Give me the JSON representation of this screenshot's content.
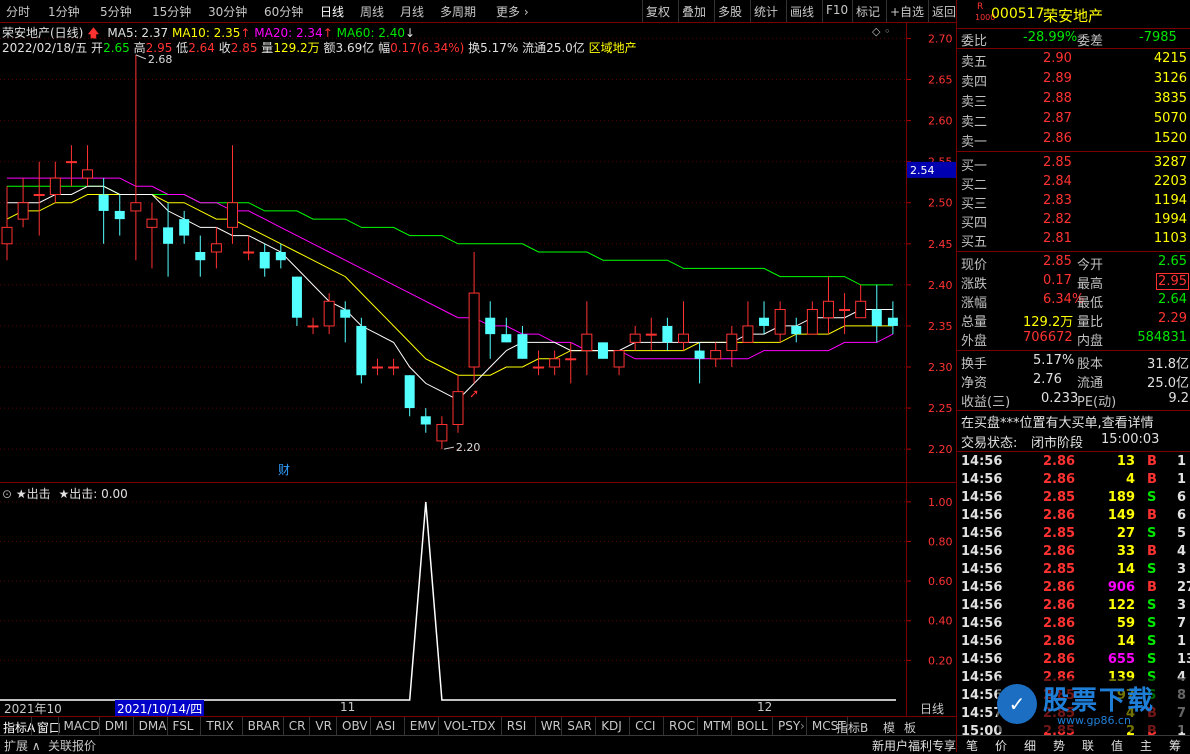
{
  "toolbar": {
    "left": [
      "分时",
      "1分钟",
      "5分钟",
      "15分钟",
      "30分钟",
      "60分钟",
      "日线",
      "周线",
      "月线",
      "多周期",
      "更多 ›"
    ],
    "right": [
      "复权",
      "叠加",
      "多股",
      "统计",
      "画线",
      "F10",
      "标记",
      "+自选",
      "返回"
    ]
  },
  "info": {
    "title": "荣安地产(日线)",
    "ma5": "MA5: 2.37",
    "ma10": "MA10: 2.35",
    "ma20": "MA20: 2.34",
    "ma60": "MA60: 2.40",
    "date": "2022/02/18/五",
    "open_l": "开",
    "open": "2.65",
    "high_l": "高",
    "high": "2.95",
    "low_l": "低",
    "low": "2.64",
    "close_l": "收",
    "close": "2.85",
    "vol_l": "量",
    "vol": "129.2万",
    "amt_l": "额",
    "amt": "3.69亿",
    "chg_l": "幅",
    "chg": "0.17(6.34%)",
    "turn": "换5.17%",
    "float": "流通25.0亿",
    "sector": "区域地产"
  },
  "sub_info": {
    "name1": "★出击",
    "name2": "★出击: 0.00"
  },
  "colors": {
    "up": "#ff3232",
    "down": "#54ffff",
    "ma5": "#ffffff",
    "ma10": "#ffff00",
    "ma20": "#ff00ff",
    "ma60": "#00ff00"
  },
  "chart_data": {
    "type": "candlestick",
    "price_axis": {
      "min": 2.16,
      "max": 2.72,
      "ticks": [
        "2.70",
        "2.65",
        "2.60",
        "2.55",
        "2.50",
        "2.45",
        "2.40",
        "2.35",
        "2.30",
        "2.25",
        "2.20"
      ],
      "current_marker": "2.54"
    },
    "sub_axis": {
      "min": 0,
      "max": 1.08,
      "ticks": [
        "1.00",
        "0.80",
        "0.60",
        "0.40",
        "0.20"
      ]
    },
    "annotations": {
      "high": "2.68",
      "low": "2.20",
      "fin": "财"
    },
    "dates": {
      "start": "2021年10",
      "cursor": "2021/10/14/四",
      "m11": "11",
      "m12": "12"
    },
    "candles": [
      [
        2.45,
        2.47,
        2.52,
        2.43
      ],
      [
        2.48,
        2.5,
        2.53,
        2.47
      ],
      [
        2.51,
        2.51,
        2.55,
        2.46
      ],
      [
        2.51,
        2.53,
        2.55,
        2.5
      ],
      [
        2.55,
        2.55,
        2.57,
        2.52
      ],
      [
        2.53,
        2.54,
        2.57,
        2.52
      ],
      [
        2.51,
        2.49,
        2.53,
        2.45
      ],
      [
        2.49,
        2.48,
        2.51,
        2.46
      ],
      [
        2.49,
        2.5,
        2.68,
        2.43
      ],
      [
        2.47,
        2.48,
        2.5,
        2.42
      ],
      [
        2.47,
        2.45,
        2.5,
        2.41
      ],
      [
        2.48,
        2.46,
        2.49,
        2.45
      ],
      [
        2.44,
        2.43,
        2.46,
        2.41
      ],
      [
        2.44,
        2.45,
        2.47,
        2.42
      ],
      [
        2.47,
        2.5,
        2.57,
        2.45
      ],
      [
        2.44,
        2.44,
        2.46,
        2.43
      ],
      [
        2.44,
        2.42,
        2.45,
        2.41
      ],
      [
        2.44,
        2.43,
        2.45,
        2.42
      ],
      [
        2.41,
        2.36,
        2.41,
        2.35
      ],
      [
        2.35,
        2.35,
        2.36,
        2.34
      ],
      [
        2.35,
        2.38,
        2.39,
        2.34
      ],
      [
        2.37,
        2.36,
        2.38,
        2.33
      ],
      [
        2.35,
        2.29,
        2.36,
        2.28
      ],
      [
        2.3,
        2.3,
        2.31,
        2.29
      ],
      [
        2.3,
        2.3,
        2.31,
        2.29
      ],
      [
        2.29,
        2.25,
        2.29,
        2.24
      ],
      [
        2.24,
        2.23,
        2.25,
        2.22
      ],
      [
        2.21,
        2.23,
        2.24,
        2.2
      ],
      [
        2.23,
        2.27,
        2.29,
        2.22
      ],
      [
        2.3,
        2.39,
        2.44,
        2.28
      ],
      [
        2.36,
        2.34,
        2.38,
        2.31
      ],
      [
        2.34,
        2.33,
        2.36,
        2.33
      ],
      [
        2.34,
        2.31,
        2.35,
        2.31
      ],
      [
        2.3,
        2.3,
        2.32,
        2.29
      ],
      [
        2.3,
        2.31,
        2.32,
        2.29
      ],
      [
        2.31,
        2.31,
        2.33,
        2.28
      ],
      [
        2.32,
        2.34,
        2.38,
        2.29
      ],
      [
        2.33,
        2.31,
        2.33,
        2.31
      ],
      [
        2.3,
        2.32,
        2.32,
        2.29
      ],
      [
        2.33,
        2.34,
        2.35,
        2.32
      ],
      [
        2.34,
        2.34,
        2.36,
        2.32
      ],
      [
        2.35,
        2.33,
        2.36,
        2.32
      ],
      [
        2.33,
        2.34,
        2.38,
        2.32
      ],
      [
        2.32,
        2.31,
        2.33,
        2.28
      ],
      [
        2.31,
        2.32,
        2.33,
        2.3
      ],
      [
        2.32,
        2.34,
        2.35,
        2.3
      ],
      [
        2.33,
        2.35,
        2.38,
        2.33
      ],
      [
        2.36,
        2.35,
        2.38,
        2.34
      ],
      [
        2.34,
        2.37,
        2.38,
        2.33
      ],
      [
        2.35,
        2.34,
        2.36,
        2.33
      ],
      [
        2.34,
        2.37,
        2.38,
        2.34
      ],
      [
        2.36,
        2.38,
        2.41,
        2.34
      ],
      [
        2.37,
        2.37,
        2.39,
        2.34
      ],
      [
        2.36,
        2.38,
        2.4,
        2.36
      ],
      [
        2.37,
        2.35,
        2.4,
        2.33
      ],
      [
        2.36,
        2.35,
        2.38,
        2.34
      ]
    ],
    "ma5": [
      2.5,
      2.5,
      2.5,
      2.51,
      2.51,
      2.52,
      2.52,
      2.51,
      2.51,
      2.51,
      2.49,
      2.48,
      2.47,
      2.47,
      2.46,
      2.46,
      2.45,
      2.44,
      2.42,
      2.4,
      2.38,
      2.37,
      2.35,
      2.34,
      2.33,
      2.3,
      2.28,
      2.27,
      2.26,
      2.28,
      2.3,
      2.32,
      2.33,
      2.33,
      2.33,
      2.32,
      2.32,
      2.32,
      2.32,
      2.33,
      2.33,
      2.33,
      2.33,
      2.33,
      2.33,
      2.33,
      2.34,
      2.34,
      2.35,
      2.35,
      2.36,
      2.36,
      2.36,
      2.37,
      2.37,
      2.37
    ],
    "ma10": [
      2.48,
      2.49,
      2.49,
      2.5,
      2.5,
      2.51,
      2.51,
      2.51,
      2.51,
      2.51,
      2.5,
      2.5,
      2.49,
      2.48,
      2.48,
      2.47,
      2.46,
      2.45,
      2.44,
      2.43,
      2.42,
      2.41,
      2.39,
      2.37,
      2.35,
      2.33,
      2.31,
      2.3,
      2.29,
      2.29,
      2.29,
      2.3,
      2.3,
      2.31,
      2.31,
      2.32,
      2.32,
      2.32,
      2.32,
      2.32,
      2.32,
      2.32,
      2.32,
      2.33,
      2.33,
      2.33,
      2.33,
      2.33,
      2.33,
      2.34,
      2.34,
      2.34,
      2.35,
      2.35,
      2.35,
      2.35
    ],
    "ma20": [
      2.53,
      2.53,
      2.53,
      2.53,
      2.53,
      2.53,
      2.53,
      2.53,
      2.52,
      2.52,
      2.51,
      2.51,
      2.5,
      2.5,
      2.49,
      2.49,
      2.48,
      2.47,
      2.46,
      2.45,
      2.44,
      2.43,
      2.42,
      2.41,
      2.4,
      2.39,
      2.38,
      2.37,
      2.36,
      2.36,
      2.35,
      2.35,
      2.34,
      2.34,
      2.33,
      2.33,
      2.32,
      2.32,
      2.32,
      2.31,
      2.31,
      2.31,
      2.31,
      2.31,
      2.31,
      2.31,
      2.31,
      2.32,
      2.32,
      2.32,
      2.32,
      2.32,
      2.33,
      2.33,
      2.33,
      2.34
    ],
    "ma60": [
      2.52,
      2.52,
      2.52,
      2.52,
      2.52,
      2.52,
      2.52,
      2.51,
      2.51,
      2.51,
      2.51,
      2.51,
      2.5,
      2.5,
      2.5,
      2.5,
      2.49,
      2.49,
      2.49,
      2.48,
      2.48,
      2.48,
      2.47,
      2.47,
      2.47,
      2.46,
      2.46,
      2.46,
      2.45,
      2.45,
      2.45,
      2.45,
      2.45,
      2.44,
      2.44,
      2.44,
      2.44,
      2.43,
      2.43,
      2.43,
      2.43,
      2.43,
      2.42,
      2.42,
      2.42,
      2.42,
      2.42,
      2.42,
      2.41,
      2.41,
      2.41,
      2.41,
      2.41,
      2.4,
      2.4,
      2.4
    ],
    "signal": {
      "peak_index": 26,
      "value": 1.0
    }
  },
  "indicators": {
    "items": [
      "指标A",
      "窗口",
      "MACD",
      "DMI",
      "DMA",
      "FSL",
      "TRIX",
      "BRAR",
      "CR",
      "VR",
      "OBV",
      "ASI",
      "EMV",
      "VOL-TDX",
      "RSI",
      "WR",
      "SAR",
      "KDJ",
      "CCI",
      "ROC",
      "MTM",
      "BOLL",
      "PSY",
      "MCST"
    ],
    "right": [
      "指标B",
      "模",
      "板"
    ]
  },
  "footer": {
    "left": [
      "扩展 ∧",
      "关联报价"
    ],
    "promo": "新用户福利专享",
    "tabs": [
      "笔",
      "价",
      "细",
      "势",
      "联",
      "值",
      "主",
      "筹"
    ],
    "period": "日线"
  },
  "panel": {
    "code": "000517",
    "name": "荣安地产",
    "badge_r": "R",
    "badge_num": "1000",
    "weibi_l": "委比",
    "weibi": "-28.99%",
    "weicha_l": "委差",
    "weicha": "-7985",
    "sells": [
      {
        "label": "卖五",
        "price": "2.90",
        "vol": "4215"
      },
      {
        "label": "卖四",
        "price": "2.89",
        "vol": "3126"
      },
      {
        "label": "卖三",
        "price": "2.88",
        "vol": "3835"
      },
      {
        "label": "卖二",
        "price": "2.87",
        "vol": "5070"
      },
      {
        "label": "卖一",
        "price": "2.86",
        "vol": "1520"
      }
    ],
    "buys": [
      {
        "label": "买一",
        "price": "2.85",
        "vol": "3287"
      },
      {
        "label": "买二",
        "price": "2.84",
        "vol": "2203"
      },
      {
        "label": "买三",
        "price": "2.83",
        "vol": "1194"
      },
      {
        "label": "买四",
        "price": "2.82",
        "vol": "1994"
      },
      {
        "label": "买五",
        "price": "2.81",
        "vol": "1103"
      }
    ],
    "stats": [
      {
        "l1": "现价",
        "v1": "2.85",
        "c1": "red",
        "l2": "今开",
        "v2": "2.65",
        "c2": "green"
      },
      {
        "l1": "涨跌",
        "v1": "0.17",
        "c1": "red",
        "l2": "最高",
        "v2": "2.95",
        "c2": "red"
      },
      {
        "l1": "涨幅",
        "v1": "6.34%",
        "c1": "red",
        "l2": "最低",
        "v2": "2.64",
        "c2": "green"
      },
      {
        "l1": "总量",
        "v1": "129.2万",
        "c1": "yellow",
        "l2": "量比",
        "v2": "2.29",
        "c2": "red"
      },
      {
        "l1": "外盘",
        "v1": "706672",
        "c1": "red",
        "l2": "内盘",
        "v2": "584831",
        "c2": "green"
      }
    ],
    "stats2": [
      {
        "l1": "换手",
        "v1": "5.17%",
        "l2": "股本",
        "v2": "31.8亿"
      },
      {
        "l1": "净资",
        "v1": "2.76",
        "l2": "流通",
        "v2": "25.0亿"
      },
      {
        "l1": "收益(三)",
        "v1": "0.233",
        "l2": "PE(动)",
        "v2": "9.2"
      }
    ],
    "notice": "在买盘***位置有大买单,查看详情",
    "status_l": "交易状态:",
    "status": "闭市阶段",
    "status_time": "15:00:03",
    "ticks": [
      {
        "t": "14:56",
        "p": "2.86",
        "v": "13",
        "s": "B",
        "n": "1",
        "vc": "yellow"
      },
      {
        "t": "14:56",
        "p": "2.86",
        "v": "4",
        "s": "B",
        "n": "1",
        "vc": "yellow"
      },
      {
        "t": "14:56",
        "p": "2.85",
        "v": "189",
        "s": "S",
        "n": "6",
        "vc": "yellow"
      },
      {
        "t": "14:56",
        "p": "2.86",
        "v": "149",
        "s": "B",
        "n": "6",
        "vc": "yellow"
      },
      {
        "t": "14:56",
        "p": "2.85",
        "v": "27",
        "s": "S",
        "n": "5",
        "vc": "yellow"
      },
      {
        "t": "14:56",
        "p": "2.86",
        "v": "33",
        "s": "B",
        "n": "4",
        "vc": "yellow"
      },
      {
        "t": "14:56",
        "p": "2.85",
        "v": "14",
        "s": "S",
        "n": "3",
        "vc": "yellow"
      },
      {
        "t": "14:56",
        "p": "2.86",
        "v": "906",
        "s": "B",
        "n": "27",
        "vc": "magenta"
      },
      {
        "t": "14:56",
        "p": "2.86",
        "v": "122",
        "s": "S",
        "n": "3",
        "vc": "yellow"
      },
      {
        "t": "14:56",
        "p": "2.86",
        "v": "59",
        "s": "S",
        "n": "7",
        "vc": "yellow"
      },
      {
        "t": "14:56",
        "p": "2.86",
        "v": "14",
        "s": "S",
        "n": "1",
        "vc": "yellow"
      },
      {
        "t": "14:56",
        "p": "2.86",
        "v": "655",
        "s": "S",
        "n": "13",
        "vc": "magenta"
      },
      {
        "t": "14:56",
        "p": "2.86",
        "v": "139",
        "s": "S",
        "n": "4",
        "vc": "yellow"
      },
      {
        "t": "14:56",
        "p": "2.85",
        "v": "97",
        "s": "S",
        "n": "8",
        "vc": "yellow"
      },
      {
        "t": "14:57",
        "p": "2.85",
        "v": "4",
        "s": "B",
        "n": "7",
        "vc": "yellow"
      },
      {
        "t": "15:00",
        "p": "2.85",
        "v": "2",
        "s": "B",
        "n": "1",
        "vc": "yellow"
      }
    ],
    "watermark": "股票下载",
    "watermark_url": "www.gp86.cn"
  }
}
